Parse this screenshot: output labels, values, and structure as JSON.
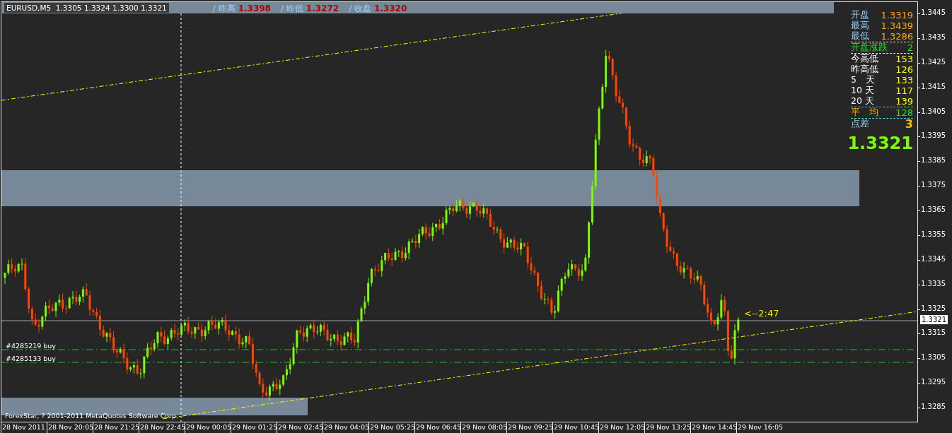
{
  "chart": {
    "symbol_info": "EURUSD,M5  1.3305 1.3324 1.3300 1.3321",
    "header_quotes": [
      {
        "label": "/ 昨高",
        "value": "1.3398"
      },
      {
        "label": "/ 昨低",
        "value": "1.3272"
      },
      {
        "label": "/ 收盘",
        "value": "1.3320"
      }
    ],
    "order_labels": [
      {
        "text": "#4285219 buy"
      },
      {
        "text": "#4285133 buy"
      }
    ],
    "countdown": "<--2:47",
    "copyright": "ForexStar, ? 2001-2011 MetaQuotes Software Corp."
  },
  "quote_panel": {
    "rows": [
      {
        "kind": "price",
        "label": "开盘",
        "value": "1.3319"
      },
      {
        "kind": "price",
        "label": "最高",
        "value": "1.3439"
      },
      {
        "kind": "price",
        "label": "最低",
        "value": "1.3286"
      },
      {
        "kind": "change",
        "label": "开盘涨跌",
        "value": "2"
      },
      {
        "kind": "range",
        "label": "今高低",
        "value": "153"
      },
      {
        "kind": "range",
        "label": "昨高低",
        "value": "126"
      },
      {
        "kind": "range",
        "label": "5　天",
        "value": "133"
      },
      {
        "kind": "range",
        "label": "10 天",
        "value": "117"
      },
      {
        "kind": "range",
        "label": "20 天",
        "value": "139"
      },
      {
        "kind": "average",
        "label": "平　均",
        "value": "128"
      },
      {
        "kind": "spread",
        "label": "点差",
        "value": "3"
      }
    ],
    "last_price": "1.3321"
  },
  "price_axis": {
    "labels": [
      "1.3445",
      "1.3435",
      "1.3425",
      "1.3415",
      "1.3405",
      "1.3395",
      "1.3385",
      "1.3375",
      "1.3365",
      "1.3355",
      "1.3345",
      "1.3335",
      "1.3325",
      "1.3315",
      "1.3305",
      "1.3295",
      "1.3285"
    ],
    "current_price": "1.3321"
  },
  "time_axis": {
    "labels": [
      "28 Nov 2011",
      "28 Nov 20:05",
      "28 Nov 21:25",
      "28 Nov 22:45",
      "29 Nov 00:05",
      "29 Nov 01:25",
      "29 Nov 02:45",
      "29 Nov 04:05",
      "29 Nov 05:25",
      "29 Nov 06:45",
      "29 Nov 08:05",
      "29 Nov 09:25",
      "29 Nov 10:45",
      "29 Nov 12:05",
      "29 Nov 13:25",
      "29 Nov 14:45",
      "29 Nov 16:05"
    ]
  }
}
